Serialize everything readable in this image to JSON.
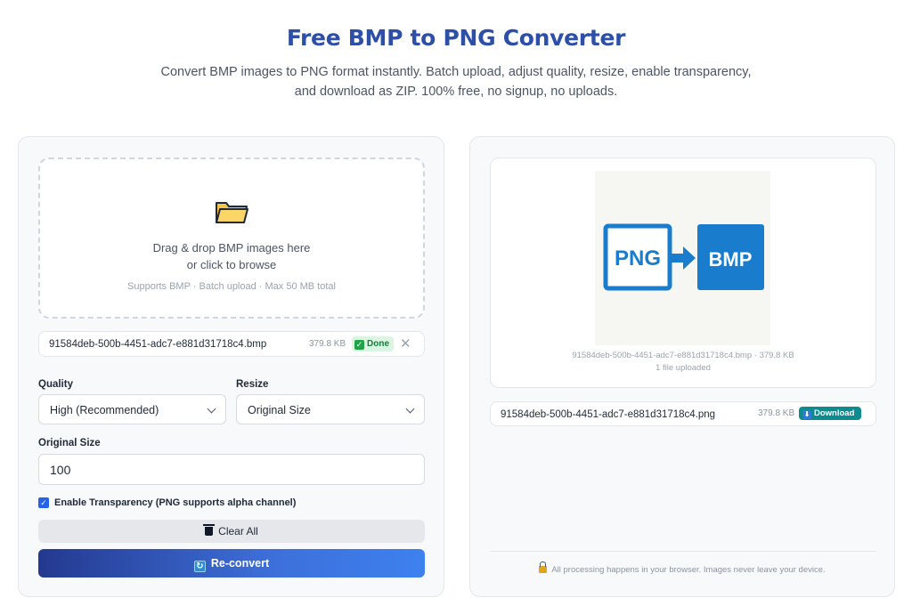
{
  "header": {
    "title": "Free BMP to PNG Converter",
    "subtitle_line1": "Convert BMP images to PNG format instantly. Batch upload, adjust quality, resize, enable transparency,",
    "subtitle_line2": "and download as ZIP. 100% free, no signup, no uploads."
  },
  "upload": {
    "icon": "folder-icon",
    "line1": "Drag & drop BMP images here",
    "line2": "or click to browse",
    "hint": "Supports BMP · Batch upload · Max 50 MB total"
  },
  "input_file": {
    "name": "91584deb-500b-4451-adc7-e881d31718c4.bmp",
    "size": "379.8 KB",
    "status": "Done"
  },
  "settings": {
    "quality_label": "Quality",
    "quality_value": "High (Recommended)",
    "resize_label": "Resize",
    "resize_value": "Original Size",
    "size_label": "Original Size",
    "size_value": "100",
    "transparency_label": "Enable Transparency (PNG supports alpha channel)",
    "transparency_checked": true
  },
  "actions": {
    "clear_label": "Clear All",
    "reconvert_label": "Re-convert"
  },
  "preview": {
    "meta": "91584deb-500b-4451-adc7-e881d31718c4.bmp · 379.8 KB",
    "count": "1 file uploaded",
    "image": {
      "left_text": "PNG",
      "right_text": "BMP",
      "color": "#1a7ccc"
    }
  },
  "output_file": {
    "name": "91584deb-500b-4451-adc7-e881d31718c4.png",
    "size": "379.8 KB",
    "download_label": "Download"
  },
  "footer": {
    "note": "All processing happens in your browser. Images never leave your device."
  },
  "colors": {
    "title": "#2e4fa8",
    "accent": "#2563eb",
    "download": "#0e8b8f",
    "done_bg": "#dcf5e3"
  }
}
